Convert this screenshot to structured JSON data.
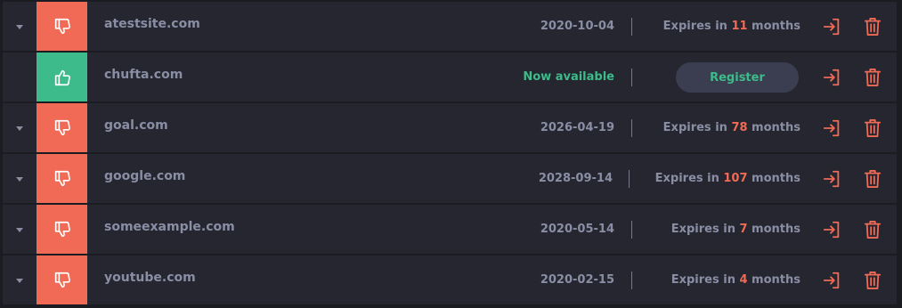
{
  "colors": {
    "accent_red": "#f06a56",
    "accent_green": "#3dbb8a",
    "text_muted": "#8a8ea5",
    "row_bg": "#25262f"
  },
  "rows": [
    {
      "domain": "atestsite.com",
      "status": "unavailable",
      "status_icon": "thumbs-down-icon",
      "date": "2020-10-04",
      "expires_prefix": "Expires in ",
      "expires_value": "11",
      "expires_suffix": " months"
    },
    {
      "domain": "chufta.com",
      "status": "available",
      "status_icon": "thumbs-up-icon",
      "availability_text": "Now available",
      "register_label": "Register"
    },
    {
      "domain": "goal.com",
      "status": "unavailable",
      "status_icon": "thumbs-down-icon",
      "date": "2026-04-19",
      "expires_prefix": "Expires in ",
      "expires_value": "78",
      "expires_suffix": " months"
    },
    {
      "domain": "google.com",
      "status": "unavailable",
      "status_icon": "thumbs-down-icon",
      "date": "2028-09-14",
      "expires_prefix": "Expires in ",
      "expires_value": "107",
      "expires_suffix": " months"
    },
    {
      "domain": "someexample.com",
      "status": "unavailable",
      "status_icon": "thumbs-down-icon",
      "date": "2020-05-14",
      "expires_prefix": "Expires in ",
      "expires_value": "7",
      "expires_suffix": " months"
    },
    {
      "domain": "youtube.com",
      "status": "unavailable",
      "status_icon": "thumbs-down-icon",
      "date": "2020-02-15",
      "expires_prefix": "Expires in ",
      "expires_value": "4",
      "expires_suffix": " months"
    }
  ],
  "action_icons": {
    "login": "login-icon",
    "delete": "trash-icon"
  }
}
